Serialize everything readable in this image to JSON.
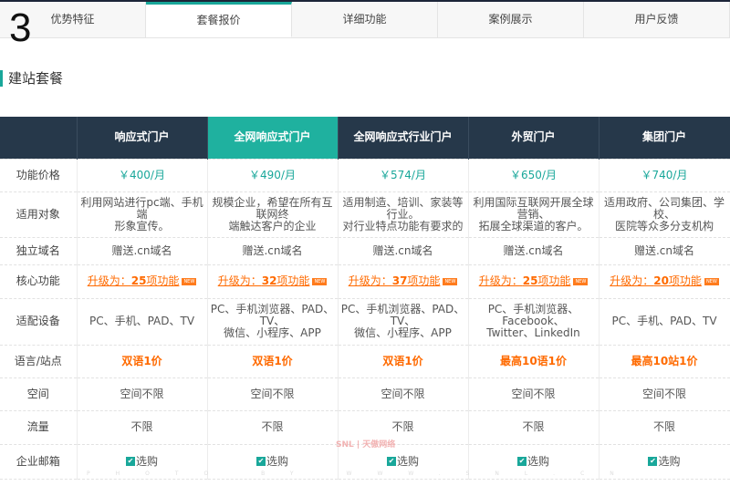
{
  "header": {
    "step_number": "3",
    "tabs": [
      {
        "label": "优势特征"
      },
      {
        "label": "套餐报价",
        "active": true
      },
      {
        "label": "详细功能"
      },
      {
        "label": "案例展示"
      },
      {
        "label": "用户反馈"
      }
    ]
  },
  "section_title": "建站套餐",
  "table": {
    "columns": [
      "响应式门户",
      "全网响应式门户",
      "全网响应式行业门户",
      "外贸门户",
      "集团门户"
    ],
    "rows": [
      {
        "label": "功能价格",
        "cells": [
          "￥400/月",
          "￥490/月",
          "￥574/月",
          "￥650/月",
          "￥740/月"
        ]
      },
      {
        "label": "适用对象",
        "cells": [
          "利用网站进行pc端、手机端\n形象宣传。",
          "规模企业，希望在所有互联网终\n端触达客户的企业",
          "适用制造、培训、家装等行业。\n对行业特点功能有要求的",
          "利用国际互联网开展全球营销、\n拓展全球渠道的客户。",
          "适用政府、公司集团、学校、\n医院等众多分支机构"
        ]
      },
      {
        "label": "独立域名",
        "cells": [
          "赠送.cn域名",
          "赠送.cn域名",
          "赠送.cn域名",
          "赠送.cn域名",
          "赠送.cn域名"
        ]
      },
      {
        "label": "核心功能",
        "upgrade_prefix": "升级为：",
        "upgrade_suffix": "项功能",
        "new_badge": "NEW",
        "cells": [
          "25",
          "32",
          "37",
          "25",
          "20"
        ]
      },
      {
        "label": "适配设备",
        "cells": [
          "PC、手机、PAD、TV",
          "PC、手机浏览器、PAD、TV、\n微信、小程序、APP",
          "PC、手机浏览器、PAD、TV、\n微信、小程序、APP",
          "PC、手机浏览器、Facebook、\nTwitter、LinkedIn",
          "PC、手机、PAD、TV"
        ]
      },
      {
        "label": "语言/站点",
        "cells": [
          "双语1价",
          "双语1价",
          "双语1价",
          "最高10语1价",
          "最高10站1价"
        ]
      },
      {
        "label": "空间",
        "cells": [
          "空间不限",
          "空间不限",
          "空间不限",
          "空间不限",
          "空间不限"
        ]
      },
      {
        "label": "流量",
        "cells": [
          "不限",
          "不限",
          "不限",
          "不限",
          "不限"
        ]
      },
      {
        "label": "企业邮箱",
        "cells": [
          "选购",
          "选购",
          "选购",
          "选购",
          "选购"
        ]
      }
    ]
  },
  "watermark": {
    "logo": "SNL | 天傲网络",
    "footer": "PHOTO BY WWW.SNL.CN"
  }
}
